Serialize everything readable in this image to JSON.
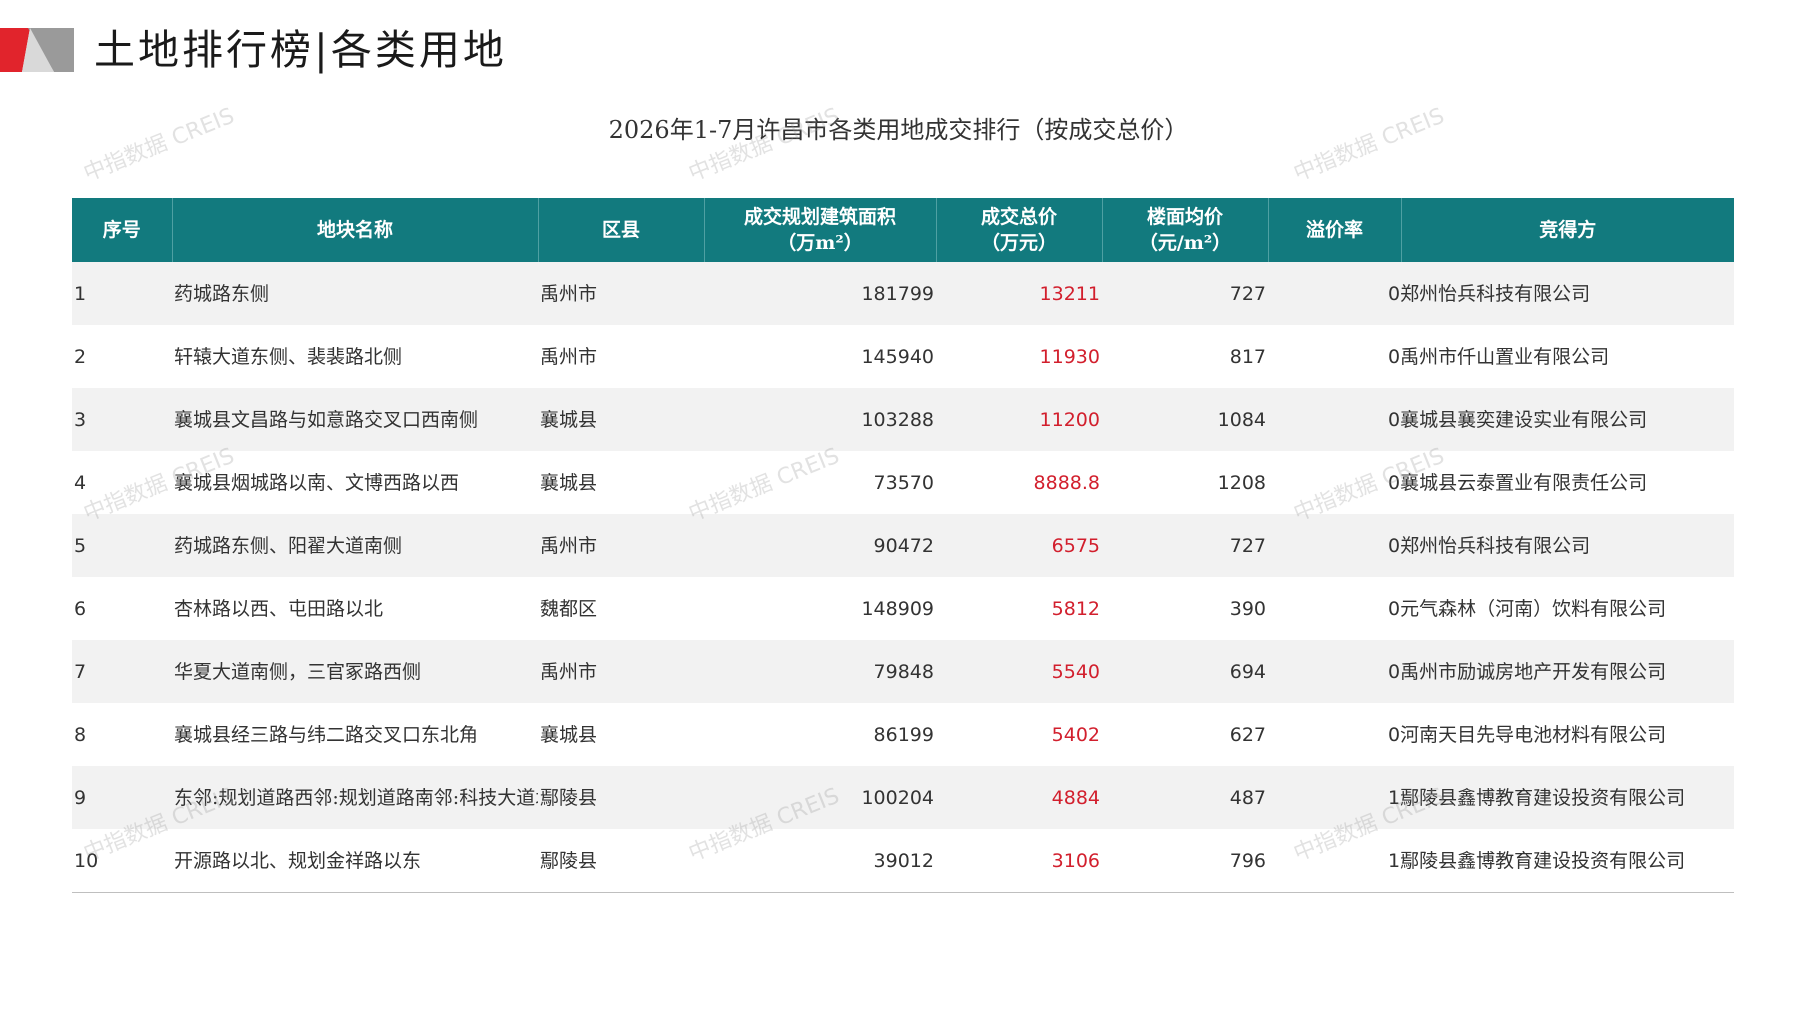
{
  "page": {
    "title": "土地排行榜|各类用地",
    "table_title": "2026年1-7月许昌市各类用地成交排行（按成交总价）",
    "watermark": "中指数据 CREIS",
    "colors": {
      "header_bg": "#127a7e",
      "accent_red": "#d21f2d",
      "logo_red": "#e1242c",
      "logo_gray": "#8c8c8c"
    }
  },
  "table": {
    "headers": {
      "index": "序号",
      "name": "地块名称",
      "district": "区县",
      "area_l1": "成交规划建筑面积",
      "area_l2": "（万m²）",
      "total_l1": "成交总价",
      "total_l2": "（万元）",
      "avg_l1": "楼面均价",
      "avg_l2": "（元/m²）",
      "premium": "溢价率",
      "winner": "竞得方"
    },
    "rows": [
      {
        "index": "1",
        "name": "药城路东侧",
        "district": "禹州市",
        "area": "181799",
        "total": "13211",
        "avg": "727",
        "premium": "0",
        "winner": "郑州怡兵科技有限公司"
      },
      {
        "index": "2",
        "name": "轩辕大道东侧、裴裴路北侧",
        "district": "禹州市",
        "area": "145940",
        "total": "11930",
        "avg": "817",
        "premium": "0",
        "winner": "禹州市仟山置业有限公司"
      },
      {
        "index": "3",
        "name": "襄城县文昌路与如意路交叉口西南侧",
        "district": "襄城县",
        "area": "103288",
        "total": "11200",
        "avg": "1084",
        "premium": "0",
        "winner": "襄城县襄奕建设实业有限公司"
      },
      {
        "index": "4",
        "name": "襄城县烟城路以南、文博西路以西",
        "district": "襄城县",
        "area": "73570",
        "total": "8888.8",
        "avg": "1208",
        "premium": "0",
        "winner": "襄城县云泰置业有限责任公司"
      },
      {
        "index": "5",
        "name": "药城路东侧、阳翟大道南侧",
        "district": "禹州市",
        "area": "90472",
        "total": "6575",
        "avg": "727",
        "premium": "0",
        "winner": "郑州怡兵科技有限公司"
      },
      {
        "index": "6",
        "name": "杏林路以西、屯田路以北",
        "district": "魏都区",
        "area": "148909",
        "total": "5812",
        "avg": "390",
        "premium": "0",
        "winner": "元气森林（河南）饮料有限公司"
      },
      {
        "index": "7",
        "name": "华夏大道南侧，三官冢路西侧",
        "district": "禹州市",
        "area": "79848",
        "total": "5540",
        "avg": "694",
        "premium": "0",
        "winner": "禹州市励诚房地产开发有限公司"
      },
      {
        "index": "8",
        "name": "襄城县经三路与纬二路交叉口东北角",
        "district": "襄城县",
        "area": "86199",
        "total": "5402",
        "avg": "627",
        "premium": "0",
        "winner": "河南天目先导电池材料有限公司"
      },
      {
        "index": "9",
        "name": "东邻:规划道路西邻:规划道路南邻:科技大道北邻:康王庙社区土地",
        "district": "鄢陵县",
        "area": "100204",
        "total": "4884",
        "avg": "487",
        "premium": "1",
        "winner": "鄢陵县鑫博教育建设投资有限公司"
      },
      {
        "index": "10",
        "name": "开源路以北、规划金祥路以东",
        "district": "鄢陵县",
        "area": "39012",
        "total": "3106",
        "avg": "796",
        "premium": "1",
        "winner": "鄢陵县鑫博教育建设投资有限公司"
      }
    ]
  }
}
